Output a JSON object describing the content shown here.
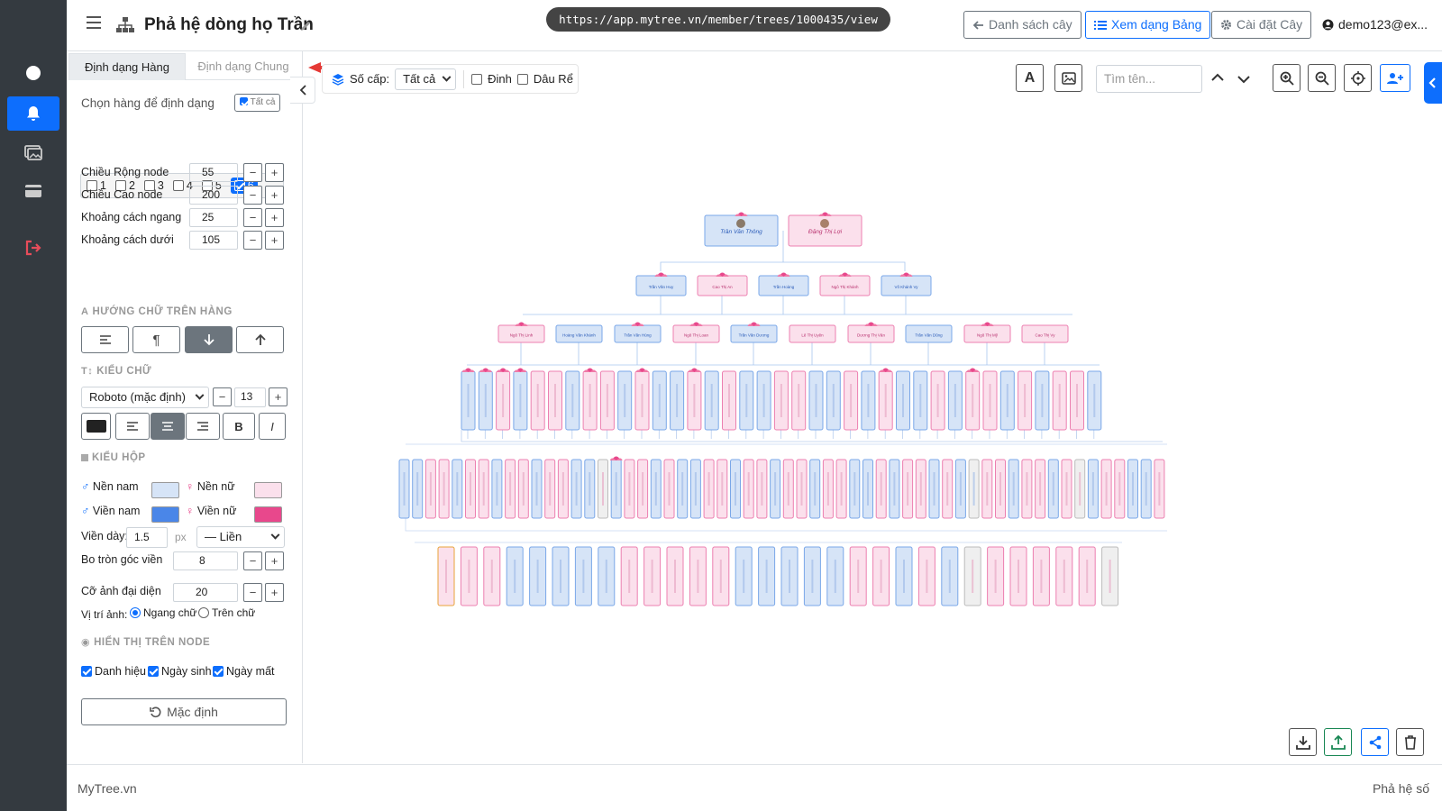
{
  "app": {
    "title": "Phả hệ dòng họ Trần",
    "url": "https://app.mytree.vn/member/trees/1000435/view",
    "user": "demo123@ex...",
    "buttons": {
      "list": "Danh sách cây",
      "table": "Xem dạng Bảng",
      "settings": "Cài đặt Cây"
    }
  },
  "panel": {
    "tabs": [
      "Định dạng Hàng",
      "Định dạng Chung"
    ],
    "select_row_label": "Chọn hàng để định dạng",
    "select_all": "Tất cả",
    "generations": [
      "1",
      "2",
      "3",
      "4",
      "5",
      "6"
    ],
    "selected_generation": "6",
    "fields": [
      {
        "label": "Chiều Rộng node",
        "value": "55"
      },
      {
        "label": "Chiều Cao node",
        "value": "200"
      },
      {
        "label": "Khoảng cách ngang",
        "value": "25"
      },
      {
        "label": "Khoảng cách dưới",
        "value": "105"
      }
    ],
    "text_direction_title": "HƯỚNG CHỮ TRÊN HÀNG",
    "font_title": "KIỂU CHỮ",
    "font_family": "Roboto (mặc định)",
    "font_size": "13",
    "bold": "B",
    "italic": "I",
    "box_title": "KIỂU HỘP",
    "male_bg": "Nền nam",
    "female_bg": "Nền nữ",
    "male_border": "Viền nam",
    "female_border": "Viền nữ",
    "border_width_label": "Viền dày:",
    "border_width": "1.5",
    "border_unit": "px",
    "border_style": "— Liền",
    "radius_label": "Bo tròn góc viền",
    "radius": "8",
    "avatar_label": "Cỡ ảnh đại diện",
    "avatar": "20",
    "avatar_pos_label": "Vị trí ảnh:",
    "avatar_pos_options": [
      "Ngang chữ",
      "Trên chữ"
    ],
    "display_title": "HIỂN THỊ TRÊN NODE",
    "display_options": [
      "Danh hiệu",
      "Ngày sinh",
      "Ngày mất"
    ],
    "reset": "Mặc định",
    "colors": {
      "male_bg": "#d6e4f7",
      "female_bg": "#fbe0ec",
      "male_border": "#4a86e8",
      "female_border": "#e8488c"
    }
  },
  "canvas": {
    "levels_label": "Số cấp:",
    "levels_value": "Tất cả",
    "filter_dinh": "Đinh",
    "filter_daure": "Dâu Rể",
    "search_placeholder": "Tìm tên...",
    "gen1": [
      "Trần Văn Thông",
      "Đặng Thị Lợi"
    ],
    "gen2": [
      "Trần Văn Huy",
      "Cao Thị An",
      "Trần Hoàng",
      "Ngô Thị Khánh",
      "Võ Khánh Vy"
    ],
    "gen3": [
      "Ngô Thị Linh",
      "Hoàng Văn Khánh",
      "Trần Văn Hùng",
      "Ngô Thị Loan",
      "Trần Văn Dương",
      "Lê Thị Uyên",
      "Dương Thị Vân",
      "Trần Văn Dũng",
      "Ngô Thị Mỹ",
      "Cao Thị Vy"
    ]
  },
  "footer": {
    "left": "MyTree.vn",
    "right": "Phả hệ số"
  }
}
